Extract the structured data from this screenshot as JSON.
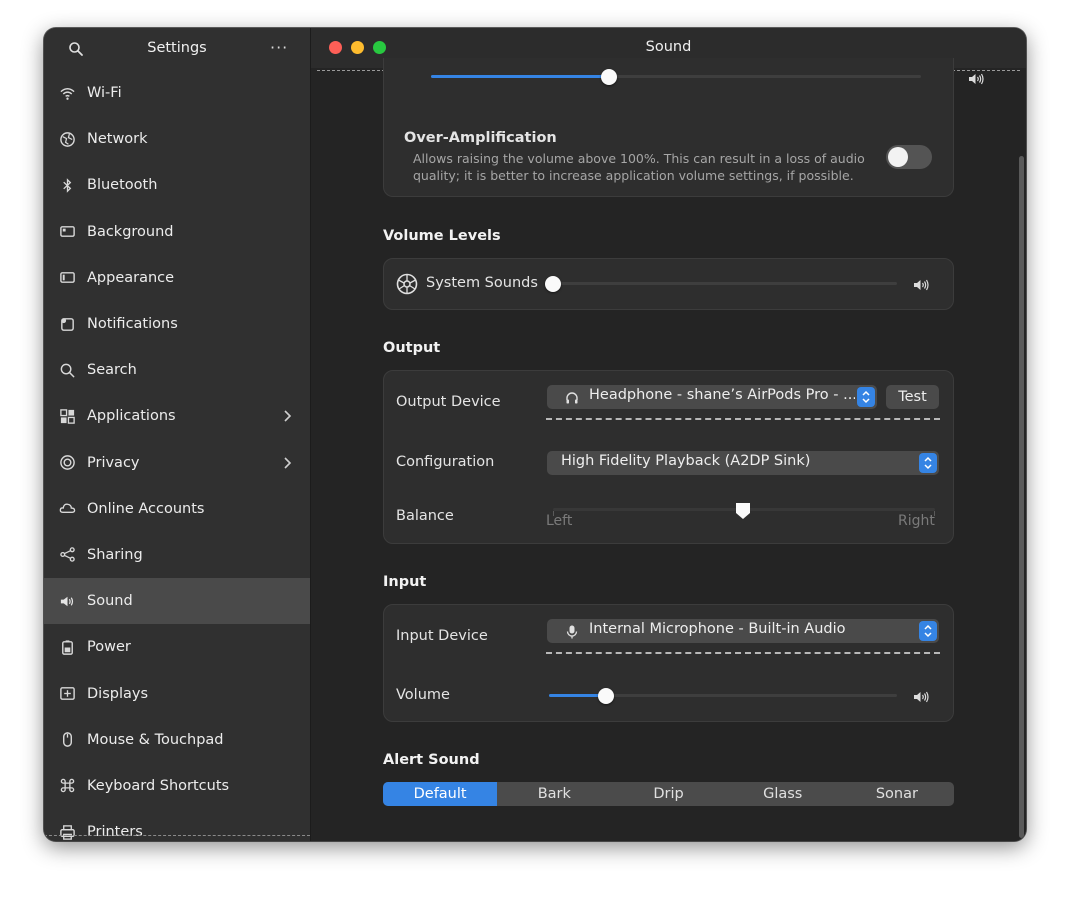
{
  "sidebar": {
    "title": "Settings",
    "more": "···",
    "items": [
      {
        "label": "Wi-Fi",
        "icon": "wifi-icon",
        "chevron": false
      },
      {
        "label": "Network",
        "icon": "network-icon",
        "chevron": false
      },
      {
        "label": "Bluetooth",
        "icon": "bluetooth-icon",
        "chevron": false
      },
      {
        "label": "Background",
        "icon": "background-icon",
        "chevron": false
      },
      {
        "label": "Appearance",
        "icon": "appearance-icon",
        "chevron": false
      },
      {
        "label": "Notifications",
        "icon": "notifications-icon",
        "chevron": false
      },
      {
        "label": "Search",
        "icon": "search-icon",
        "chevron": false
      },
      {
        "label": "Applications",
        "icon": "applications-icon",
        "chevron": true
      },
      {
        "label": "Privacy",
        "icon": "privacy-icon",
        "chevron": true
      },
      {
        "label": "Online Accounts",
        "icon": "cloud-icon",
        "chevron": false
      },
      {
        "label": "Sharing",
        "icon": "share-icon",
        "chevron": false
      },
      {
        "label": "Sound",
        "icon": "speaker-icon",
        "chevron": false
      },
      {
        "label": "Power",
        "icon": "battery-icon",
        "chevron": false
      },
      {
        "label": "Displays",
        "icon": "display-icon",
        "chevron": false
      },
      {
        "label": "Mouse & Touchpad",
        "icon": "mouse-icon",
        "chevron": false
      },
      {
        "label": "Keyboard Shortcuts",
        "icon": "command-icon",
        "chevron": false
      },
      {
        "label": "Printers",
        "icon": "printer-icon",
        "chevron": false
      }
    ],
    "active_item": "Sound"
  },
  "window": {
    "title": "Sound"
  },
  "top_volume": {
    "level": 0.4
  },
  "over_amplification": {
    "title": "Over-Amplification",
    "description_line1": "Allows raising the volume above 100%. This can result in a loss of audio",
    "description_line2": "quality; it is better to increase application volume settings, if possible.",
    "enabled": false
  },
  "volume_levels": {
    "title": "Volume Levels",
    "system_sounds_label": "System Sounds",
    "system_sounds_level": 0.0
  },
  "output": {
    "title": "Output",
    "device_label": "Output Device",
    "device_value": "Headphone - shane’s AirPods Pro - ...",
    "test_label": "Test",
    "configuration_label": "Configuration",
    "configuration_value": "High Fidelity Playback (A2DP Sink)",
    "balance_label": "Balance",
    "balance_left": "Left",
    "balance_right": "Right",
    "balance_value": 0.5
  },
  "input": {
    "title": "Input",
    "device_label": "Input Device",
    "device_value": "Internal Microphone - Built-in Audio",
    "volume_label": "Volume",
    "volume_level": 0.17
  },
  "alert_sound": {
    "title": "Alert Sound",
    "options": [
      "Default",
      "Bark",
      "Drip",
      "Glass",
      "Sonar"
    ],
    "selected": "Default"
  },
  "colors": {
    "accent": "#3584e4",
    "window_bg": "#242424",
    "sidebar_bg": "#303030",
    "card_bg": "#2e2e2e"
  }
}
